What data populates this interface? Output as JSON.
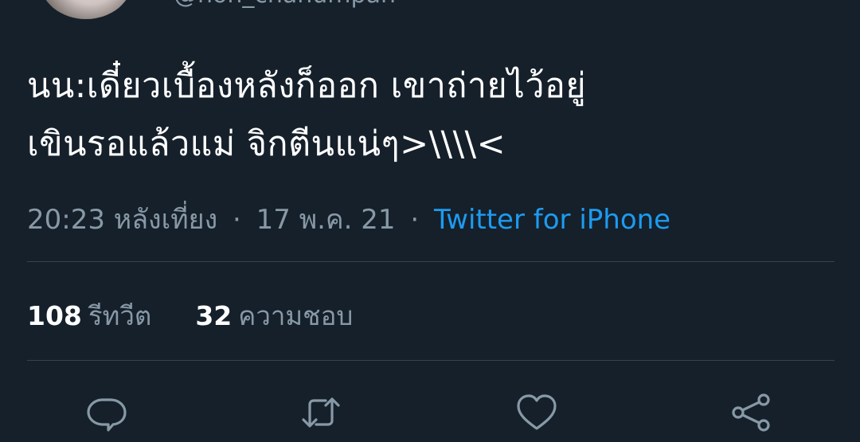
{
  "header": {
    "handle": "@non_chanumpan"
  },
  "tweet": {
    "text_lines": [
      "นน:เดี๋ยวเบื้องหลังก็ออก เขาถ่ายไว้อยู่",
      "เขินรอแล้วแม่ จิกตีนแน่ๆ>\\\\\\\\<"
    ],
    "time": "20:23 หลังเที่ยง",
    "date": "17 พ.ค. 21",
    "separator": "·",
    "source": "Twitter for iPhone"
  },
  "stats": {
    "retweets_count": "108",
    "retweets_label": "รีทวีต",
    "likes_count": "32",
    "likes_label": "ความชอบ"
  },
  "actions": {
    "icons": [
      "reply-icon",
      "retweet-icon",
      "like-icon",
      "share-icon"
    ]
  },
  "colors": {
    "background": "#15202b",
    "text": "#ffffff",
    "secondary": "#8899a6",
    "link": "#1d9bf0",
    "divider": "#38444d"
  }
}
